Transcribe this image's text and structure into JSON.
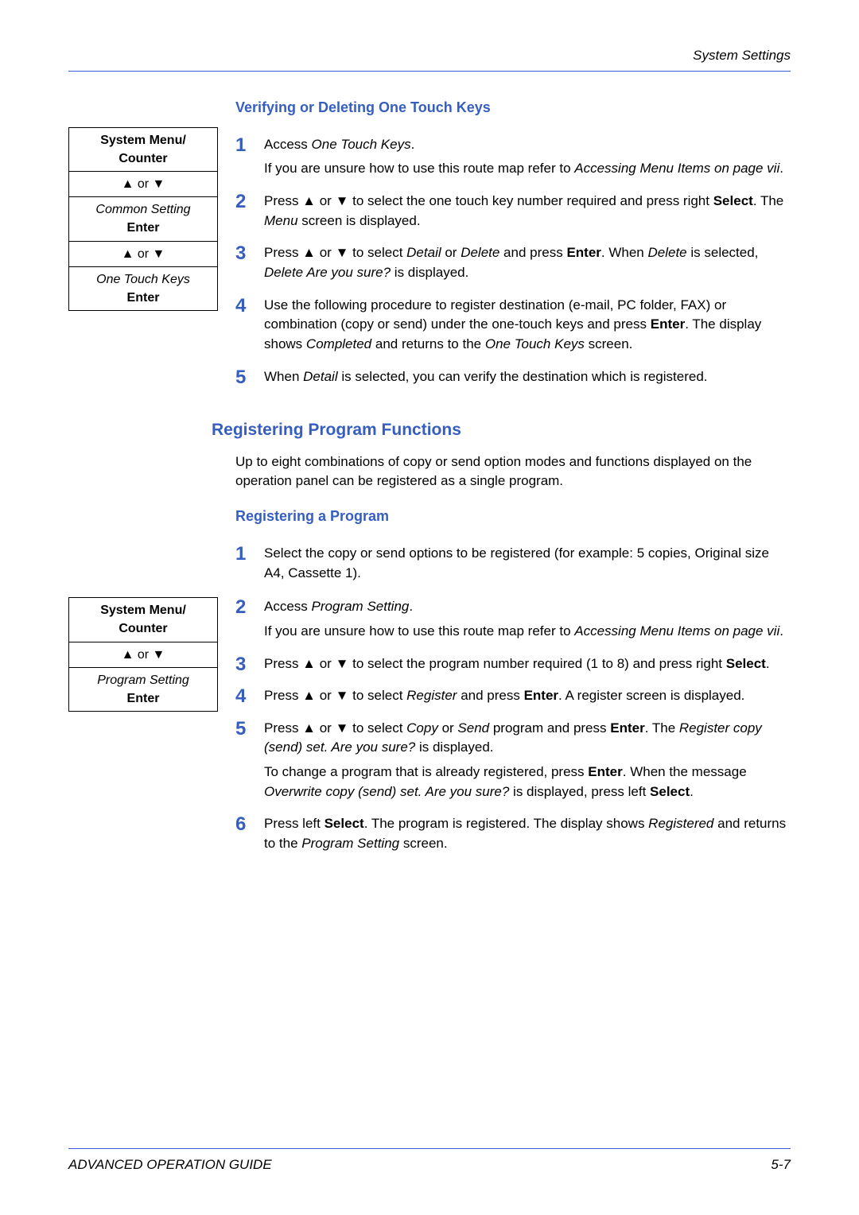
{
  "header": {
    "running": "System Settings"
  },
  "routemap1": {
    "r1a": "System Menu/",
    "r1b": "Counter",
    "r2": "▲ or ▼",
    "r3a": "Common Setting",
    "r3b": "Enter",
    "r4": "▲ or ▼",
    "r5a": "One Touch Keys",
    "r5b": "Enter"
  },
  "routemap2": {
    "r1a": "System Menu/",
    "r1b": "Counter",
    "r2": "▲ or ▼",
    "r3a": "Program Setting",
    "r3b": "Enter"
  },
  "section1": {
    "title": "Verifying or Deleting One Touch Keys",
    "s1n": "1",
    "s1a": "Access ",
    "s1b": "One Touch Keys",
    "s1c": ".",
    "s1d": "If you are unsure how to use this route map refer to ",
    "s1e": "Accessing Menu Items on page vii",
    "s1f": ".",
    "s2n": "2",
    "s2a": "Press ▲ or ▼ to select the one touch key number required and press right ",
    "s2b": "Select",
    "s2c": ". The ",
    "s2d": "Menu",
    "s2e": " screen is displayed.",
    "s3n": "3",
    "s3a": "Press ▲ or ▼ to select ",
    "s3b": "Detail",
    "s3c": " or ",
    "s3d": "Delete",
    "s3e": " and press ",
    "s3f": "Enter",
    "s3g": ". When ",
    "s3h": "Delete",
    "s3i": " is selected, ",
    "s3j": "Delete Are you sure?",
    "s3k": " is displayed.",
    "s4n": "4",
    "s4a": "Use the following procedure to register destination (e-mail, PC folder, FAX) or combination (copy or send) under the one-touch keys and press ",
    "s4b": "Enter",
    "s4c": ". The display shows ",
    "s4d": "Completed",
    "s4e": " and returns to the ",
    "s4f": "One Touch Keys",
    "s4g": " screen.",
    "s5n": "5",
    "s5a": "When ",
    "s5b": "Detail",
    "s5c": " is selected, you can verify the destination which is registered."
  },
  "section2": {
    "title": "Registering Program Functions",
    "intro": "Up to eight combinations of copy or send option modes and functions displayed on the operation panel can be registered as a single program.",
    "subtitle": "Registering a Program",
    "s1n": "1",
    "s1a": "Select the copy or send options to be registered (for example: 5 copies, Original size A4, Cassette 1).",
    "s2n": "2",
    "s2a": "Access ",
    "s2b": "Program Setting",
    "s2c": ".",
    "s2d": "If you are unsure how to use this route map refer to ",
    "s2e": "Accessing Menu Items on page vii",
    "s2f": ".",
    "s3n": "3",
    "s3a": "Press ▲ or ▼ to select the program number required (1 to 8) and press right ",
    "s3b": "Select",
    "s3c": ".",
    "s4n": "4",
    "s4a": "Press ▲ or ▼ to select ",
    "s4b": "Register",
    "s4c": " and press ",
    "s4d": "Enter",
    "s4e": ". A register screen is displayed.",
    "s5n": "5",
    "s5a": "Press ▲ or ▼ to select ",
    "s5b": "Copy",
    "s5c": " or ",
    "s5d": "Send",
    "s5e": " program and press ",
    "s5f": "Enter",
    "s5g": ". The ",
    "s5h": "Register copy (send) set. Are you sure?",
    "s5i": " is displayed.",
    "s5j": "To change a program that is already registered, press ",
    "s5k": "Enter",
    "s5l": ". When the message ",
    "s5m": "Overwrite copy (send) set. Are you sure?",
    "s5n2": " is displayed, press left ",
    "s5o": "Select",
    "s5p": ".",
    "s6n": "6",
    "s6a": "Press left ",
    "s6b": "Select",
    "s6c": ". The program is registered. The display shows ",
    "s6d": "Registered",
    "s6e": " and returns to the ",
    "s6f": "Program Setting",
    "s6g": " screen."
  },
  "footer": {
    "left": "ADVANCED OPERATION GUIDE",
    "right": "5-7"
  }
}
